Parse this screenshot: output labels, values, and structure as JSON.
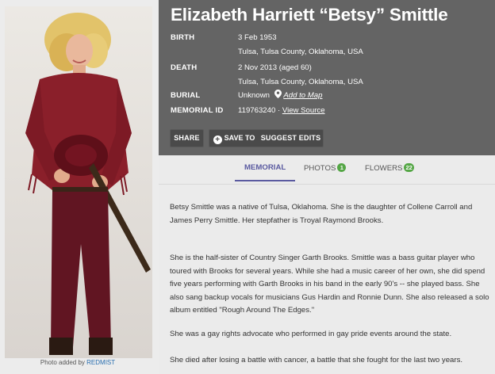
{
  "memorial": {
    "name": "Elizabeth Harriett “Betsy” Smittle",
    "birth_label": "BIRTH",
    "birth_date": "3 Feb 1953",
    "birth_place": "Tulsa, Tulsa County, Oklahoma, USA",
    "death_label": "DEATH",
    "death_date": "2 Nov 2013 (aged 60)",
    "death_place": "Tulsa, Tulsa County, Oklahoma, USA",
    "burial_label": "BURIAL",
    "burial_value": "Unknown",
    "add_to_map": "Add to Map",
    "memorial_id_label": "MEMORIAL ID",
    "memorial_id": "119763240 ·",
    "view_source": "View Source"
  },
  "actions": {
    "share": "SHARE",
    "save_to": "SAVE TO",
    "suggest_edits": "SUGGEST EDITS"
  },
  "photo": {
    "credit_prefix": "Photo added by",
    "credit_user": "REDMIST"
  },
  "tabs": {
    "memorial": "MEMORIAL",
    "photos": "PHOTOS",
    "photos_count": "1",
    "flowers": "FLOWERS",
    "flowers_count": "22"
  },
  "bio": {
    "p1": "Betsy Smittle was a native of Tulsa, Oklahoma. She is the daughter of Collene Carroll and James Perry Smittle. Her stepfather is Troyal Raymond Brooks.",
    "p2": "She is the half-sister of Country Singer Garth Brooks. Smittle was a bass guitar player who toured with Brooks for several years. While she had a music career of her own, she did spend five years performing with Garth Brooks in his band in the early 90's -- she played bass. She also sang backup vocals for musicians Gus Hardin and Ronnie Dunn. She also released a solo album entitled \"Rough Around The Edges.\"",
    "p3": "She was a gay rights advocate who performed in gay pride events around the state.",
    "p4": "She died after losing a battle with cancer, a battle that she fought for the last two years."
  },
  "colors": {
    "header_bg": "#646464",
    "page_bg": "#ebebeb",
    "accent": "#5a5aa0",
    "badge": "#54a645",
    "link": "#2a6fb0"
  },
  "icons": {
    "map_pin": "map-pin-icon",
    "add": "plus-circle-icon"
  }
}
